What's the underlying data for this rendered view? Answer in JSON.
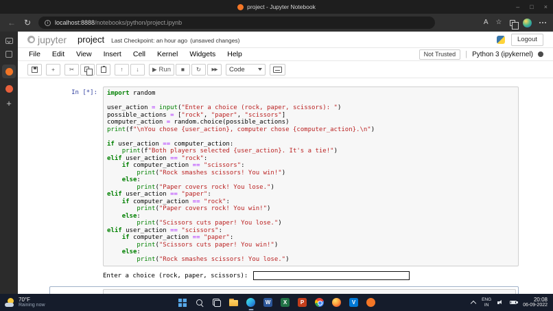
{
  "titlebar": {
    "title": "project - Jupyter Notebook"
  },
  "browser": {
    "url_host": "localhost:8888",
    "url_path": "/notebooks/python/project.ipynb"
  },
  "header": {
    "logo_text": "jupyter",
    "notebook_name": "project",
    "checkpoint_label": "Last Checkpoint: an hour ago",
    "unsaved_label": "(unsaved changes)",
    "logout_label": "Logout"
  },
  "menubar": {
    "items": [
      "File",
      "Edit",
      "View",
      "Insert",
      "Cell",
      "Kernel",
      "Widgets",
      "Help"
    ],
    "not_trusted_label": "Not Trusted",
    "kernel_label": "Python 3 (ipykernel)"
  },
  "toolbar": {
    "run_label": "Run",
    "cell_type_value": "Code",
    "glyphs": {
      "cut": "✂",
      "up": "↑",
      "down": "↓",
      "run": "▶",
      "stop": "■",
      "restart": "↻",
      "fastforward": "▶▶"
    }
  },
  "glyphs": {
    "back": "←",
    "refresh": "↻",
    "star": "☆",
    "read_aloud": "A",
    "minimize": "–",
    "maximize": "□",
    "close": "×",
    "new_tab": "+"
  },
  "cell": {
    "prompt": "In [*]:",
    "code": [
      [
        [
          "k",
          "import"
        ],
        [
          "t",
          " random"
        ]
      ],
      [],
      [
        [
          "t",
          "user_action "
        ],
        [
          "o",
          "="
        ],
        [
          "t",
          " "
        ],
        [
          "b",
          "input"
        ],
        [
          "t",
          "("
        ],
        [
          "s",
          "\"Enter a choice (rock, paper, scissors): \""
        ],
        [
          "t",
          ")"
        ]
      ],
      [
        [
          "t",
          "possible_actions "
        ],
        [
          "o",
          "="
        ],
        [
          "t",
          " ["
        ],
        [
          "s",
          "\"rock\""
        ],
        [
          "t",
          ", "
        ],
        [
          "s",
          "\"paper\""
        ],
        [
          "t",
          ", "
        ],
        [
          "s",
          "\"scissors\""
        ],
        [
          "t",
          "]"
        ]
      ],
      [
        [
          "t",
          "computer_action "
        ],
        [
          "o",
          "="
        ],
        [
          "t",
          " random.choice(possible_actions)"
        ]
      ],
      [
        [
          "b",
          "print"
        ],
        [
          "t",
          "(f"
        ],
        [
          "s",
          "\"\\nYou chose {user_action}, computer chose {computer_action}.\\n\""
        ],
        [
          "t",
          ")"
        ]
      ],
      [],
      [
        [
          "k",
          "if"
        ],
        [
          "t",
          " user_action "
        ],
        [
          "o",
          "=="
        ],
        [
          "t",
          " computer_action:"
        ]
      ],
      [
        [
          "t",
          "    "
        ],
        [
          "b",
          "print"
        ],
        [
          "t",
          "(f"
        ],
        [
          "s",
          "\"Both players selected {user_action}. It's a tie!\""
        ],
        [
          "t",
          ")"
        ]
      ],
      [
        [
          "k",
          "elif"
        ],
        [
          "t",
          " user_action "
        ],
        [
          "o",
          "=="
        ],
        [
          "t",
          " "
        ],
        [
          "s",
          "\"rock\""
        ],
        [
          "t",
          ":"
        ]
      ],
      [
        [
          "t",
          "    "
        ],
        [
          "k",
          "if"
        ],
        [
          "t",
          " computer_action "
        ],
        [
          "o",
          "=="
        ],
        [
          "t",
          " "
        ],
        [
          "s",
          "\"scissors\""
        ],
        [
          "t",
          ":"
        ]
      ],
      [
        [
          "t",
          "        "
        ],
        [
          "b",
          "print"
        ],
        [
          "t",
          "("
        ],
        [
          "s",
          "\"Rock smashes scissors! You win!\""
        ],
        [
          "t",
          ")"
        ]
      ],
      [
        [
          "t",
          "    "
        ],
        [
          "k",
          "else"
        ],
        [
          "t",
          ":"
        ]
      ],
      [
        [
          "t",
          "        "
        ],
        [
          "b",
          "print"
        ],
        [
          "t",
          "("
        ],
        [
          "s",
          "\"Paper covers rock! You lose.\""
        ],
        [
          "t",
          ")"
        ]
      ],
      [
        [
          "k",
          "elif"
        ],
        [
          "t",
          " user_action "
        ],
        [
          "o",
          "=="
        ],
        [
          "t",
          " "
        ],
        [
          "s",
          "\"paper\""
        ],
        [
          "t",
          ":"
        ]
      ],
      [
        [
          "t",
          "    "
        ],
        [
          "k",
          "if"
        ],
        [
          "t",
          " computer_action "
        ],
        [
          "o",
          "=="
        ],
        [
          "t",
          " "
        ],
        [
          "s",
          "\"rock\""
        ],
        [
          "t",
          ":"
        ]
      ],
      [
        [
          "t",
          "        "
        ],
        [
          "b",
          "print"
        ],
        [
          "t",
          "("
        ],
        [
          "s",
          "\"Paper covers rock! You win!\""
        ],
        [
          "t",
          ")"
        ]
      ],
      [
        [
          "t",
          "    "
        ],
        [
          "k",
          "else"
        ],
        [
          "t",
          ":"
        ]
      ],
      [
        [
          "t",
          "        "
        ],
        [
          "b",
          "print"
        ],
        [
          "t",
          "("
        ],
        [
          "s",
          "\"Scissors cuts paper! You lose.\""
        ],
        [
          "t",
          ")"
        ]
      ],
      [
        [
          "k",
          "elif"
        ],
        [
          "t",
          " user_action "
        ],
        [
          "o",
          "=="
        ],
        [
          "t",
          " "
        ],
        [
          "s",
          "\"scissors\""
        ],
        [
          "t",
          ":"
        ]
      ],
      [
        [
          "t",
          "    "
        ],
        [
          "k",
          "if"
        ],
        [
          "t",
          " computer_action "
        ],
        [
          "o",
          "=="
        ],
        [
          "t",
          " "
        ],
        [
          "s",
          "\"paper\""
        ],
        [
          "t",
          ":"
        ]
      ],
      [
        [
          "t",
          "        "
        ],
        [
          "b",
          "print"
        ],
        [
          "t",
          "("
        ],
        [
          "s",
          "\"Scissors cuts paper! You win!\""
        ],
        [
          "t",
          ")"
        ]
      ],
      [
        [
          "t",
          "    "
        ],
        [
          "k",
          "else"
        ],
        [
          "t",
          ":"
        ]
      ],
      [
        [
          "t",
          "        "
        ],
        [
          "b",
          "print"
        ],
        [
          "t",
          "("
        ],
        [
          "s",
          "\"Rock smashes scissors! You lose.\""
        ],
        [
          "t",
          ")"
        ]
      ]
    ]
  },
  "output": {
    "stdout": "Enter a choice (rock, paper, scissors): "
  },
  "taskbar": {
    "weather_temp": "70°F",
    "weather_desc": "Raining now",
    "apps": [
      {
        "name": "start-button",
        "css": "icon-win"
      },
      {
        "name": "search-button",
        "css": "icon-search-wrap"
      },
      {
        "name": "task-view-button",
        "css": "icon-taskview"
      },
      {
        "name": "file-explorer",
        "css": "icon-folder"
      },
      {
        "name": "edge-browser",
        "css": "icon-edge",
        "active": true
      },
      {
        "name": "word",
        "css": "app-square",
        "color": "#2b579a",
        "glyph": "W"
      },
      {
        "name": "excel",
        "css": "app-square",
        "color": "#217346",
        "glyph": "X"
      },
      {
        "name": "powerpoint",
        "css": "app-square",
        "color": "#c43e1c",
        "glyph": "P"
      },
      {
        "name": "chrome-browser",
        "css": "icon-chrome"
      },
      {
        "name": "firefox-browser",
        "css": "icon-firefox"
      },
      {
        "name": "vscode",
        "css": "app-square",
        "color": "#0078d4",
        "glyph": "V"
      },
      {
        "name": "jupyter-notebook-app",
        "css": "app-circle",
        "color": "#f37626"
      }
    ],
    "lang_top": "ENG",
    "lang_bottom": "IN",
    "time": "20:08",
    "date": "06-09-2022"
  },
  "colors": {
    "jupyter_orange": "#f37626",
    "syntax_keyword": "#008000",
    "syntax_string": "#BA2121",
    "syntax_operator": "#AA22FF",
    "prompt_blue": "#303F9F"
  }
}
